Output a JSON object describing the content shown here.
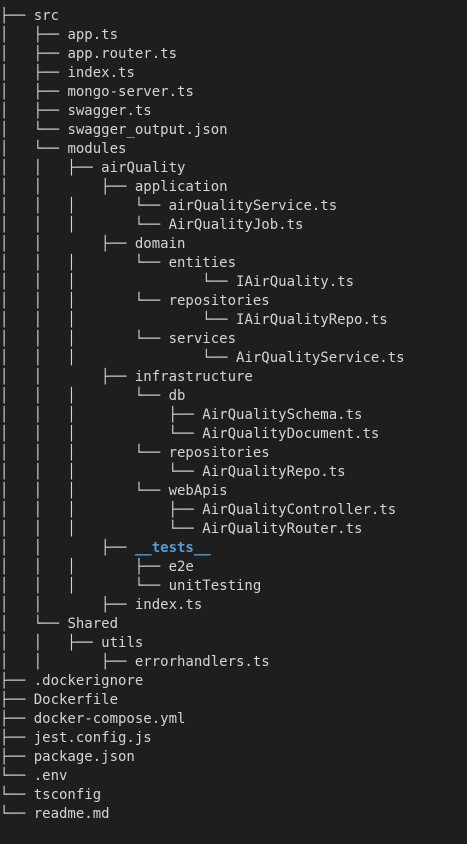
{
  "tree": [
    {
      "prefix": "├── ",
      "name": "src",
      "type": "folder"
    },
    {
      "prefix": "│   ├── ",
      "name": "app.ts",
      "type": "file"
    },
    {
      "prefix": "│   ├── ",
      "name": "app.router.ts",
      "type": "file"
    },
    {
      "prefix": "│   ├── ",
      "name": "index.ts",
      "type": "file"
    },
    {
      "prefix": "│   ├── ",
      "name": "mongo-server.ts",
      "type": "file"
    },
    {
      "prefix": "│   ├── ",
      "name": "swagger.ts",
      "type": "file"
    },
    {
      "prefix": "│   └── ",
      "name": "swagger_output.json",
      "type": "file"
    },
    {
      "prefix": "│   └── ",
      "name": "modules",
      "type": "folder"
    },
    {
      "prefix": "│   │   ├── ",
      "name": "airQuality",
      "type": "folder"
    },
    {
      "prefix": "│   │       ├── ",
      "name": "application",
      "type": "folder"
    },
    {
      "prefix": "│   │   │       └── ",
      "name": "airQualityService.ts",
      "type": "file"
    },
    {
      "prefix": "│   │   │       └── ",
      "name": "AirQualityJob.ts",
      "type": "file"
    },
    {
      "prefix": "│   │       ├── ",
      "name": "domain",
      "type": "folder"
    },
    {
      "prefix": "│   │   │       └── ",
      "name": "entities",
      "type": "folder"
    },
    {
      "prefix": "│   │   │               └── ",
      "name": "IAirQuality.ts",
      "type": "file"
    },
    {
      "prefix": "│   │   │       └── ",
      "name": "repositories",
      "type": "folder"
    },
    {
      "prefix": "│   │   │               └── ",
      "name": "IAirQualityRepo.ts",
      "type": "file"
    },
    {
      "prefix": "│   │   │       └── ",
      "name": "services",
      "type": "folder"
    },
    {
      "prefix": "│   │   │               └── ",
      "name": "AirQualityService.ts",
      "type": "file"
    },
    {
      "prefix": "│   │       ├── ",
      "name": "infrastructure",
      "type": "folder"
    },
    {
      "prefix": "│   │   │       └── ",
      "name": "db",
      "type": "folder"
    },
    {
      "prefix": "│   │   │           ├── ",
      "name": "AirQualitySchema.ts",
      "type": "file"
    },
    {
      "prefix": "│   │   │           └── ",
      "name": "AirQualityDocument.ts",
      "type": "file"
    },
    {
      "prefix": "│   │   │       └── ",
      "name": "repositories",
      "type": "folder"
    },
    {
      "prefix": "│   │   │           └── ",
      "name": "AirQualityRepo.ts",
      "type": "file"
    },
    {
      "prefix": "│   │   │       └── ",
      "name": "webApis",
      "type": "folder"
    },
    {
      "prefix": "│   │   │           ├── ",
      "name": "AirQualityController.ts",
      "type": "file"
    },
    {
      "prefix": "│   │   │           └── ",
      "name": "AirQualityRouter.ts",
      "type": "file"
    },
    {
      "prefix": "│   │       ├── ",
      "name": "__tests__",
      "type": "folder",
      "highlight": true
    },
    {
      "prefix": "│   │   │       ├── ",
      "name": "e2e",
      "type": "folder"
    },
    {
      "prefix": "│   │   │       └── ",
      "name": "unitTesting",
      "type": "folder"
    },
    {
      "prefix": "│   │       ├── ",
      "name": "index.ts",
      "type": "file"
    },
    {
      "prefix": "│   └── ",
      "name": "Shared",
      "type": "folder"
    },
    {
      "prefix": "│   │   ├── ",
      "name": "utils",
      "type": "folder"
    },
    {
      "prefix": "│   │       ├── ",
      "name": "errorhandlers.ts",
      "type": "file"
    },
    {
      "prefix": "├── ",
      "name": ".dockerignore",
      "type": "file"
    },
    {
      "prefix": "├── ",
      "name": "Dockerfile",
      "type": "file"
    },
    {
      "prefix": "├── ",
      "name": "docker-compose.yml",
      "type": "file"
    },
    {
      "prefix": "├── ",
      "name": "jest.config.js",
      "type": "file"
    },
    {
      "prefix": "├── ",
      "name": "package.json",
      "type": "file"
    },
    {
      "prefix": "└── ",
      "name": ".env",
      "type": "file"
    },
    {
      "prefix": "└── ",
      "name": "tsconfig",
      "type": "file"
    },
    {
      "prefix": "└── ",
      "name": "readme.md",
      "type": "file"
    }
  ],
  "colors": {
    "background": "#1e1e1e",
    "text": "#d4d4d4",
    "highlight": "#569cd6"
  }
}
